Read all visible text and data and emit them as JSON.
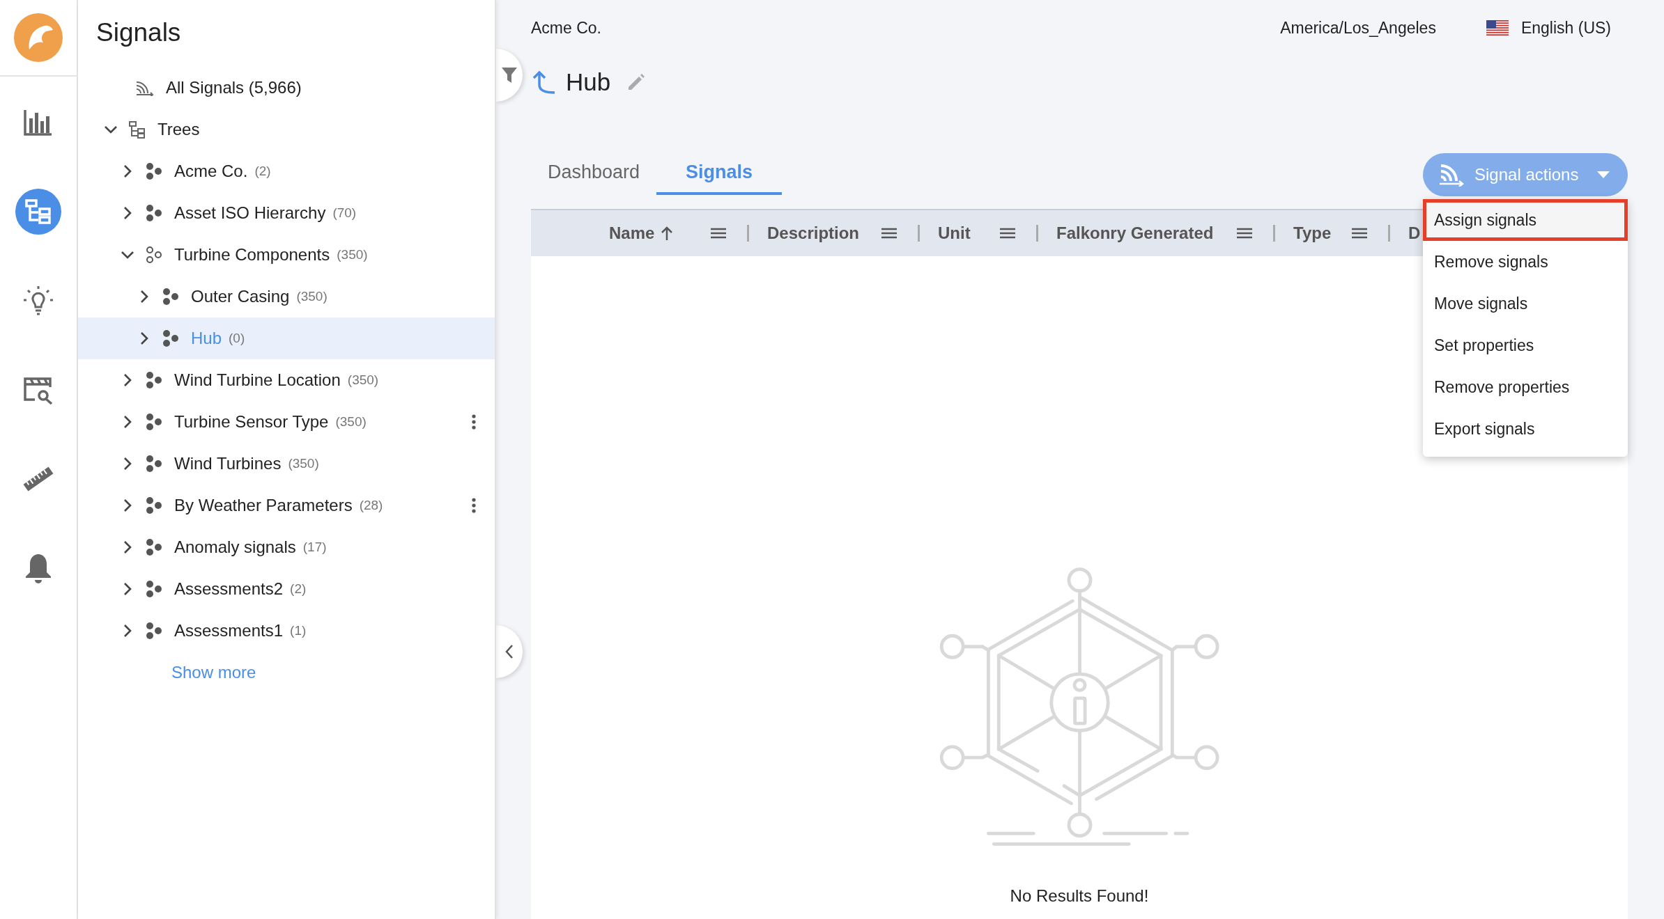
{
  "nav": [
    {
      "kind": "chart",
      "selected": false
    },
    {
      "kind": "tree",
      "selected": true
    },
    {
      "kind": "bulb",
      "selected": false
    },
    {
      "kind": "calendar-search",
      "selected": false
    },
    {
      "kind": "ruler",
      "selected": false
    },
    {
      "kind": "bell",
      "selected": false
    }
  ],
  "panel": {
    "title": "Signals",
    "items": [
      {
        "kind": "all",
        "label": "All Signals (5,966)"
      },
      {
        "kind": "group",
        "label": "Trees",
        "expanded": true,
        "children": [
          {
            "label": "Acme Co.",
            "count": "(2)",
            "expanded": false,
            "selected": false,
            "has_menu": false
          },
          {
            "label": "Asset ISO Hierarchy",
            "count": "(70)",
            "expanded": false,
            "selected": false,
            "has_menu": false
          },
          {
            "label": "Turbine Components",
            "count": "(350)",
            "expanded": true,
            "selected": false,
            "has_menu": false,
            "children": [
              {
                "label": "Outer Casing",
                "count": "(350)",
                "expanded": false,
                "selected": false,
                "has_menu": false
              },
              {
                "label": "Hub",
                "count": "(0)",
                "expanded": false,
                "selected": true,
                "has_menu": false
              }
            ]
          },
          {
            "label": "Wind Turbine Location",
            "count": "(350)",
            "expanded": false,
            "selected": false,
            "has_menu": false
          },
          {
            "label": "Turbine Sensor Type",
            "count": "(350)",
            "expanded": false,
            "selected": false,
            "has_menu": true
          },
          {
            "label": "Wind Turbines",
            "count": "(350)",
            "expanded": false,
            "selected": false,
            "has_menu": false
          },
          {
            "label": "By Weather Parameters",
            "count": "(28)",
            "expanded": false,
            "selected": false,
            "has_menu": true
          },
          {
            "label": "Anomaly signals",
            "count": "(17)",
            "expanded": false,
            "selected": false,
            "has_menu": false
          },
          {
            "label": "Assessments2",
            "count": "(2)",
            "expanded": false,
            "selected": false,
            "has_menu": false
          },
          {
            "label": "Assessments1",
            "count": "(1)",
            "expanded": false,
            "selected": false,
            "has_menu": false
          }
        ]
      }
    ],
    "show_more": "Show more"
  },
  "header": {
    "org": "Acme Co.",
    "timezone": "America/Los_Angeles",
    "language": "English (US)"
  },
  "page": {
    "title": "Hub"
  },
  "tabs": [
    {
      "label": "Dashboard",
      "selected": false
    },
    {
      "label": "Signals",
      "selected": true
    }
  ],
  "signal_actions": {
    "label": "Signal actions",
    "open": true,
    "items": [
      {
        "label": "Assign signals",
        "highlighted": true
      },
      {
        "label": "Remove signals",
        "highlighted": false
      },
      {
        "label": "Move signals",
        "highlighted": false
      },
      {
        "label": "Set properties",
        "highlighted": false
      },
      {
        "label": "Remove properties",
        "highlighted": false
      },
      {
        "label": "Export signals",
        "highlighted": false
      }
    ]
  },
  "table": {
    "columns": [
      {
        "label": "Name",
        "sorted": true
      },
      {
        "label": "Description",
        "sorted": false
      },
      {
        "label": "Unit",
        "sorted": false
      },
      {
        "label": "Falkonry Generated",
        "sorted": false
      },
      {
        "label": "Type",
        "sorted": false
      },
      {
        "label": "D",
        "sorted": false
      }
    ],
    "empty_message": "No Results Found!"
  }
}
